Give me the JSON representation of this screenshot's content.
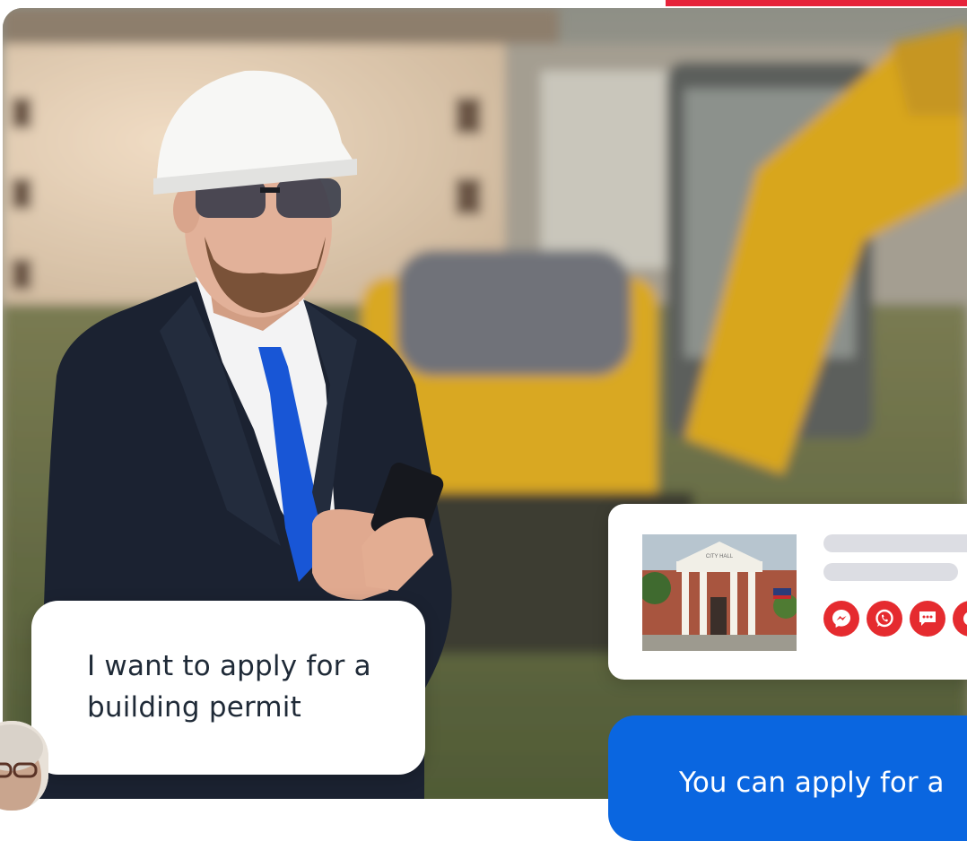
{
  "colors": {
    "accent": "#e6233a",
    "channel": "#e52b2f",
    "bot_bubble": "#0a66e0"
  },
  "hero": {
    "image": "construction-manager-with-phone-photo"
  },
  "chat": {
    "user_message": "I want to apply for a building permit",
    "bot_message": "You can apply for a"
  },
  "card": {
    "thumbnail_sign": "CITY HALL",
    "channels": [
      {
        "icon": "messenger-icon"
      },
      {
        "icon": "whatsapp-icon"
      },
      {
        "icon": "sms-icon"
      },
      {
        "icon": "chat-icon"
      }
    ]
  }
}
